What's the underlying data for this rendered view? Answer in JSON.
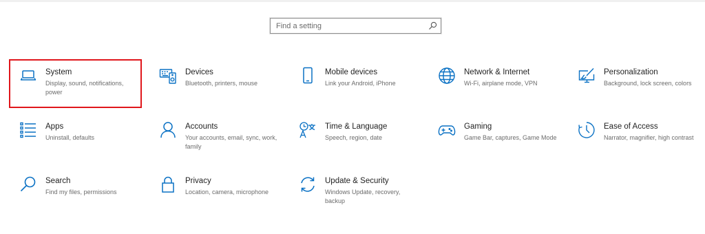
{
  "search": {
    "placeholder": "Find a setting",
    "icon": "search-icon"
  },
  "accent_color": "#0a71c4",
  "highlight_color": "#e0161b",
  "tiles": [
    {
      "title": "System",
      "desc": "Display, sound, notifications, power",
      "icon": "laptop-icon"
    },
    {
      "title": "Devices",
      "desc": "Bluetooth, printers, mouse",
      "icon": "keyboard-speaker-icon"
    },
    {
      "title": "Mobile devices",
      "desc": "Link your Android, iPhone",
      "icon": "phone-icon"
    },
    {
      "title": "Network & Internet",
      "desc": "Wi-Fi, airplane mode, VPN",
      "icon": "globe-icon"
    },
    {
      "title": "Personalization",
      "desc": "Background, lock screen, colors",
      "icon": "paintbrush-monitor-icon"
    },
    {
      "title": "Apps",
      "desc": "Uninstall, defaults",
      "icon": "apps-list-icon"
    },
    {
      "title": "Accounts",
      "desc": "Your accounts, email, sync, work, family",
      "icon": "person-icon"
    },
    {
      "title": "Time & Language",
      "desc": "Speech, region, date",
      "icon": "time-language-icon"
    },
    {
      "title": "Gaming",
      "desc": "Game Bar, captures, Game Mode",
      "icon": "gamepad-icon"
    },
    {
      "title": "Ease of Access",
      "desc": "Narrator, magnifier, high contrast",
      "icon": "ease-of-access-icon"
    },
    {
      "title": "Search",
      "desc": "Find my files, permissions",
      "icon": "magnifier-icon"
    },
    {
      "title": "Privacy",
      "desc": "Location, camera, microphone",
      "icon": "lock-icon"
    },
    {
      "title": "Update & Security",
      "desc": "Windows Update, recovery, backup",
      "icon": "sync-arrows-icon"
    }
  ]
}
